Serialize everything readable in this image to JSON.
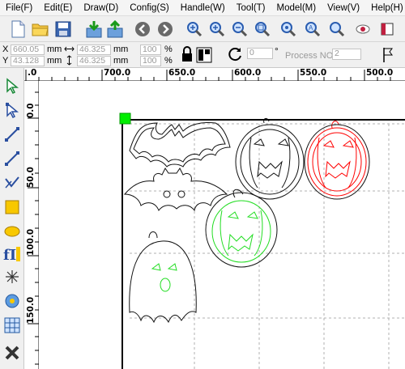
{
  "menu": [
    "File(F)",
    "Edit(E)",
    "Draw(D)",
    "Config(S)",
    "Handle(W)",
    "Tool(T)",
    "Model(M)",
    "View(V)",
    "Help(H)"
  ],
  "toolbar": {
    "icons": [
      "new-file-icon",
      "open-folder-icon",
      "save-icon",
      "import-icon",
      "export-icon",
      "back-icon",
      "forward-icon",
      "zoom-in-icon",
      "zoom-in-2-icon",
      "zoom-out-icon",
      "zoom-page-icon",
      "zoom-all-icon",
      "zoom-select-icon",
      "zoom-window-icon",
      "view-eye-icon",
      "box-icon"
    ]
  },
  "props": {
    "x_label": "X",
    "y_label": "Y",
    "x_value": "660.05",
    "y_value": "43.128",
    "unit_mm": "mm",
    "width_value": "46.325",
    "height_value": "46.325",
    "scale_x": "100",
    "scale_y": "100",
    "percent": "%",
    "rotation_value": "0",
    "degree": "°",
    "process_label": "Process NO:",
    "process_value": "2"
  },
  "ruler": {
    "h_ticks": [
      ".0",
      "700.0",
      "650.0",
      "600.0",
      "550.0",
      "500.0"
    ],
    "v_ticks": [
      "0.0",
      "50.0",
      "100.0",
      "150.0"
    ]
  },
  "colors": {
    "outline": "#000000",
    "shape_black": "#111111",
    "shape_red": "#ff0000",
    "shape_green": "#22dd22",
    "handle": "#00ee00",
    "grid": "#b0b0b0"
  }
}
